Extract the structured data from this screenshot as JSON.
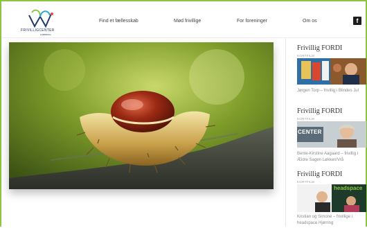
{
  "header": {
    "logo_name": "FRIVILLIGCENTER",
    "logo_sub": "HJØRRING",
    "nav": [
      {
        "label": "Find et fællesskab"
      },
      {
        "label": "Mød frivillige"
      },
      {
        "label": "For foreninger"
      },
      {
        "label": "Om os"
      }
    ],
    "social_icon": "facebook-icon",
    "social_glyph": "f"
  },
  "hero": {
    "subject": "chestnut-in-shell-photo"
  },
  "sidebar": {
    "items": [
      {
        "title": "Frivillig FORDI",
        "tag": "KORTFILM",
        "caption": "Jørgen Torp – frivillig i Blindes Jul"
      },
      {
        "title": "Frivillig FORDI",
        "tag": "KORTFILM",
        "caption": "Bente-Kirstine Aagaard – frivillig i Ældre Sagen Løkken/Vrå"
      },
      {
        "title": "Frivillig FORDI",
        "tag": "KORTFILM",
        "caption": "Kristian og Simone – frivillige i headspace Hjørring"
      }
    ],
    "thumb2_text": "CENTER",
    "thumb3_text": "headspace"
  },
  "colors": {
    "frame_green": "#8cc63f",
    "logo_blue": "#223a6b"
  }
}
